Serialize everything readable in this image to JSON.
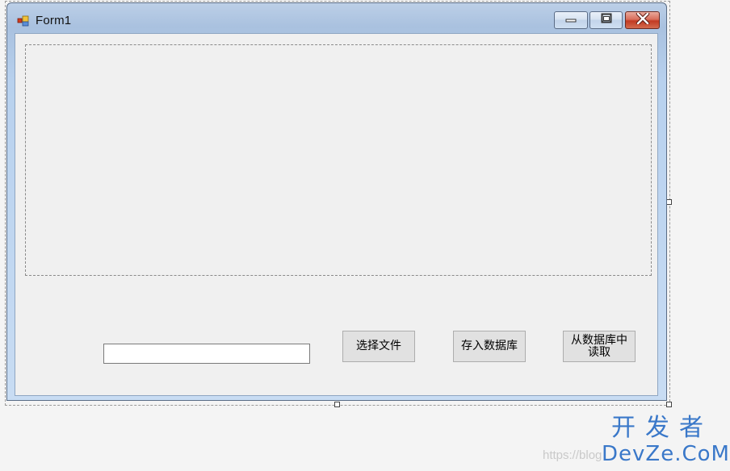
{
  "window": {
    "title": "Form1",
    "icons": {
      "app": "form-app-icon",
      "minimize": "minimize-icon",
      "maximize": "maximize-icon",
      "close": "close-icon"
    },
    "colors": {
      "close_button": "#c23a22",
      "frame": "#b8d1ee",
      "client": "#f0f0f0"
    }
  },
  "form": {
    "file_path_value": "",
    "buttons": {
      "select_file": "选择文件",
      "save_to_db": "存入数据库",
      "read_from_db_line1": "从数据库中",
      "read_from_db_line2": "读取"
    }
  },
  "watermark": {
    "url_text": "https://blog",
    "logo_cn": "开发者",
    "logo_en": "DevZe.CoM"
  }
}
